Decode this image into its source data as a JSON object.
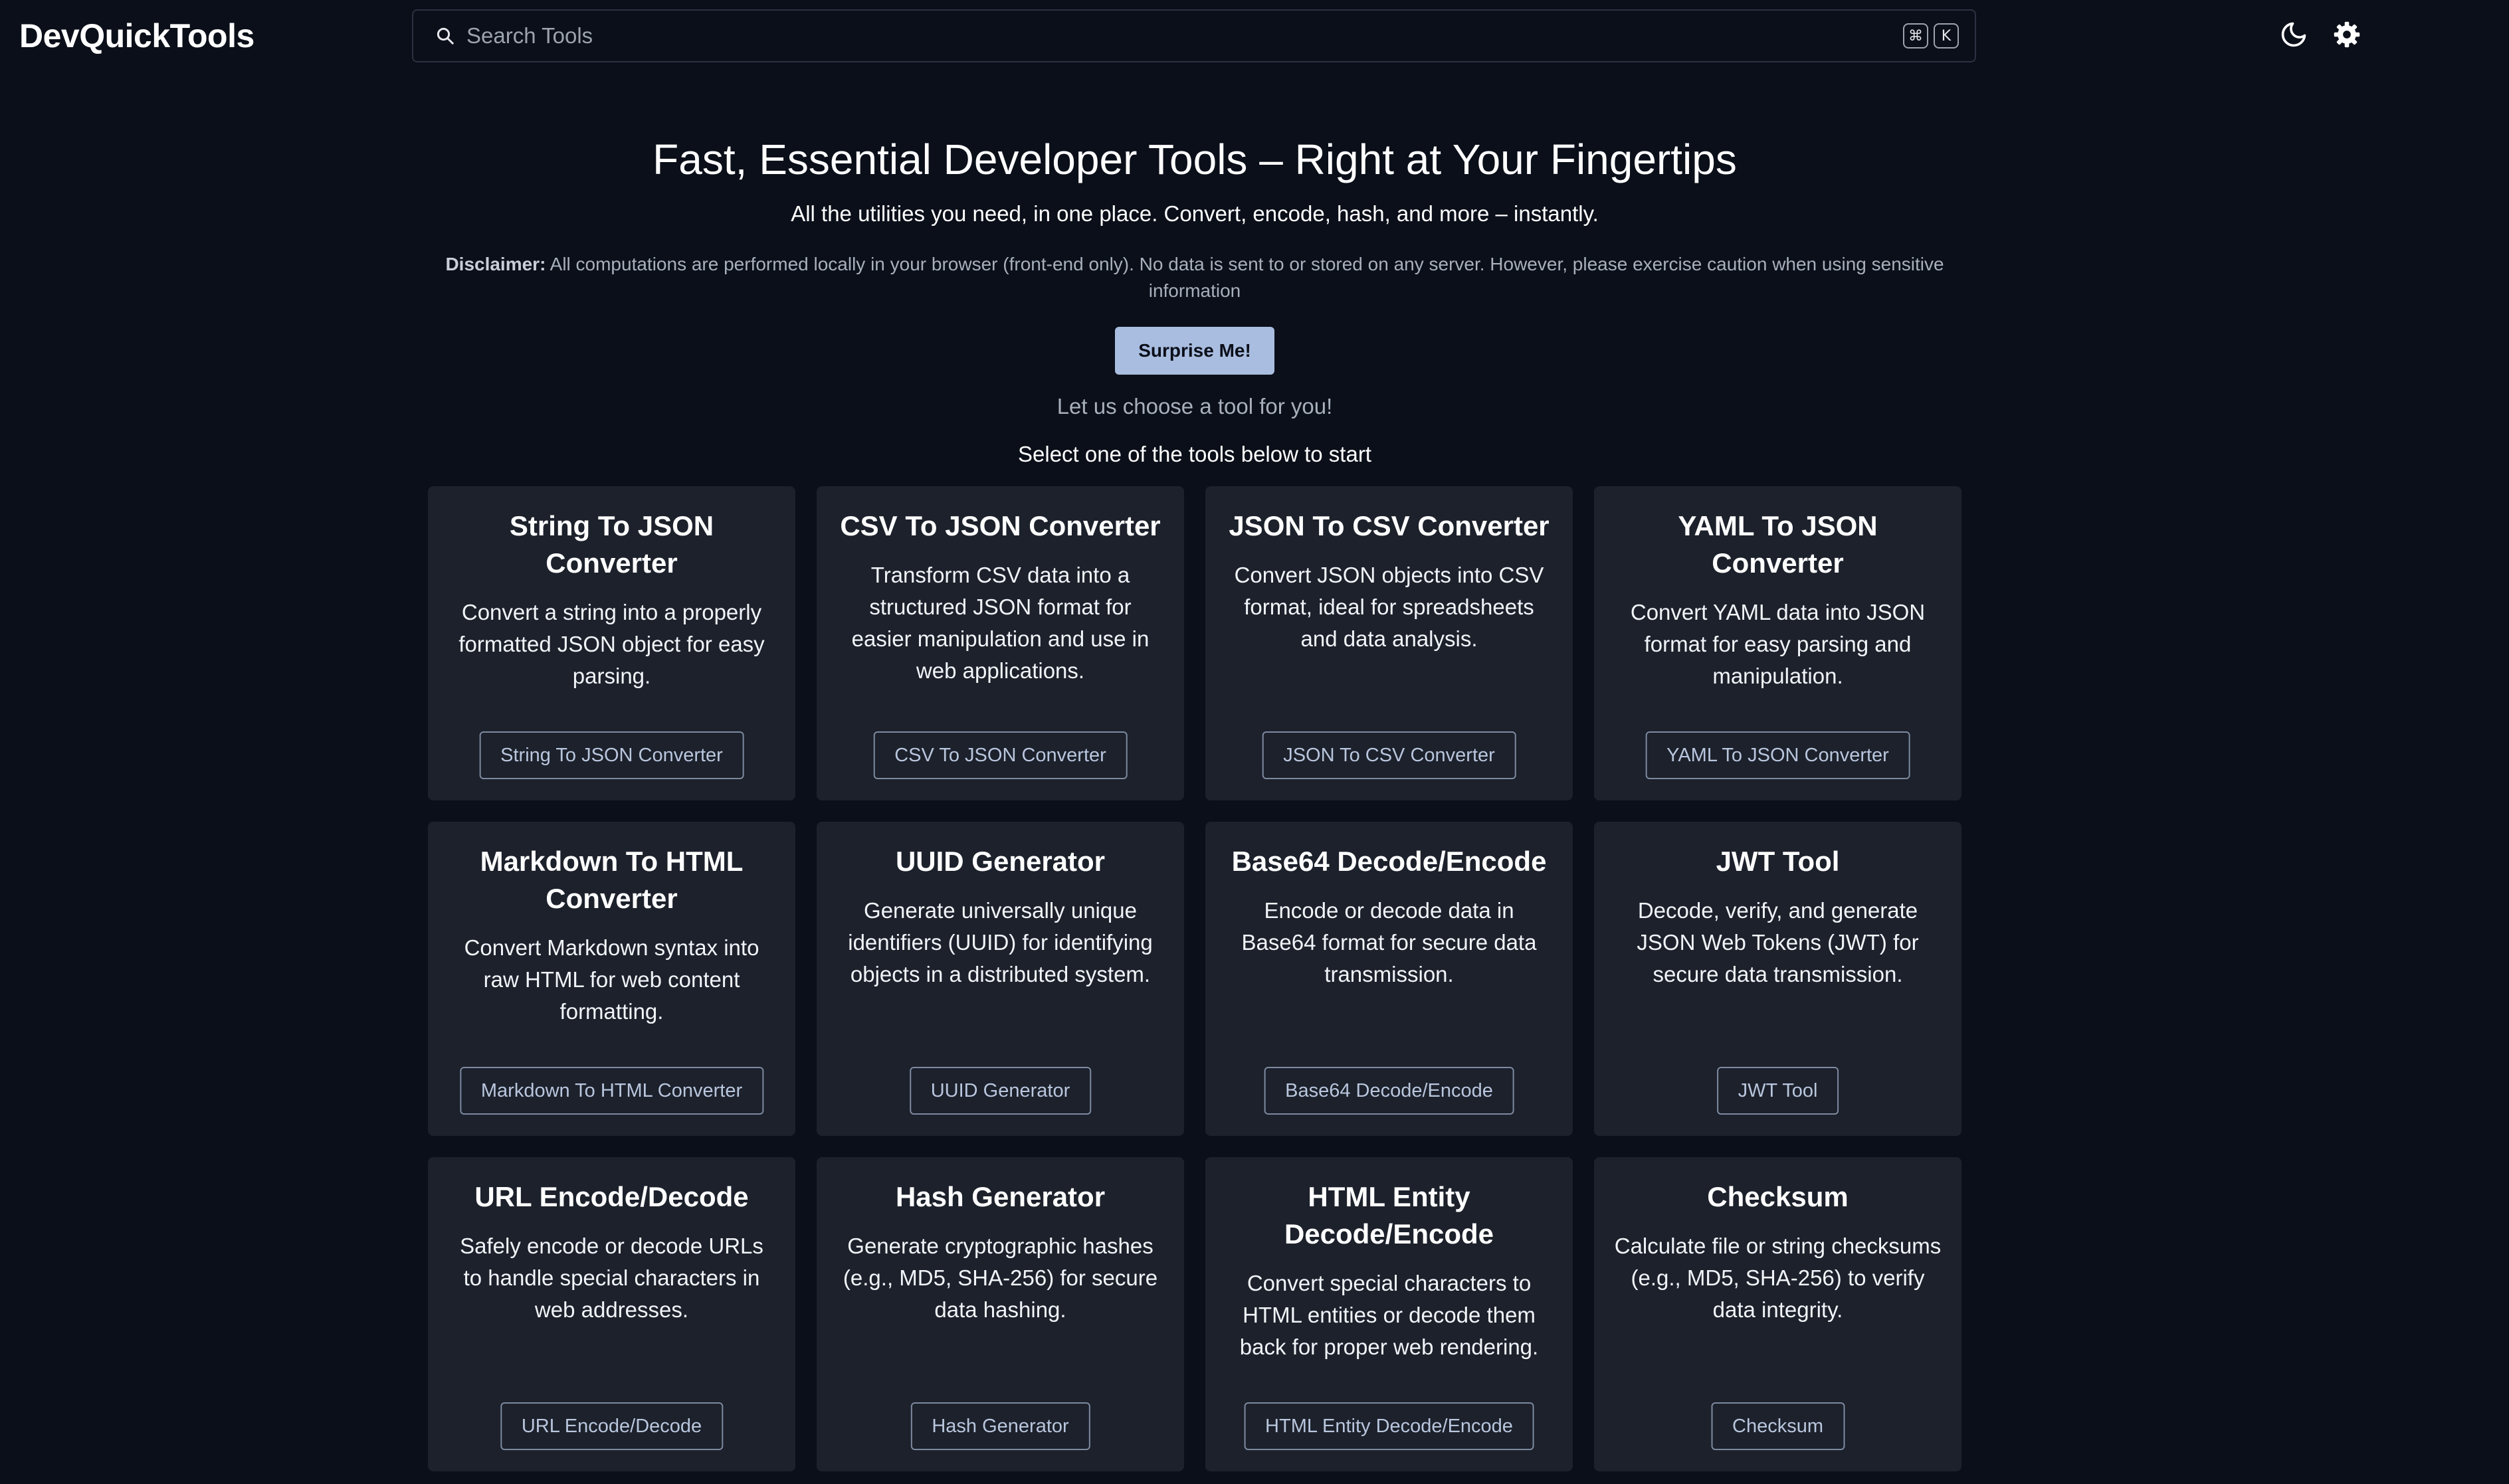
{
  "header": {
    "brand": "DevQuickTools",
    "search_placeholder": "Search Tools",
    "shortcut_keys": [
      "⌘",
      "K"
    ],
    "icons": [
      "search-icon",
      "moon-icon",
      "gear-icon"
    ]
  },
  "hero": {
    "title": "Fast, Essential Developer Tools – Right at Your Fingertips",
    "subtitle": "All the utilities you need, in one place. Convert, encode, hash, and more – instantly.",
    "disclaimer_label": "Disclaimer:",
    "disclaimer_text": " All computations are performed locally in your browser (front-end only). No data is sent to or stored on any server. However, please exercise caution when using sensitive information",
    "surprise_label": "Surprise Me!",
    "surprise_note": "Let us choose a tool for you!",
    "select_note": "Select one of the tools below to start"
  },
  "tools": [
    {
      "title": "String To JSON Converter",
      "description": "Convert a string into a properly formatted JSON object for easy parsing.",
      "button": "String To JSON Converter"
    },
    {
      "title": "CSV To JSON Converter",
      "description": "Transform CSV data into a structured JSON format for easier manipulation and use in web applications.",
      "button": "CSV To JSON Converter"
    },
    {
      "title": "JSON To CSV Converter",
      "description": "Convert JSON objects into CSV format, ideal for spreadsheets and data analysis.",
      "button": "JSON To CSV Converter"
    },
    {
      "title": "YAML To JSON Converter",
      "description": "Convert YAML data into JSON format for easy parsing and manipulation.",
      "button": "YAML To JSON Converter"
    },
    {
      "title": "Markdown To HTML Converter",
      "description": "Convert Markdown syntax into raw HTML for web content formatting.",
      "button": "Markdown To HTML Converter"
    },
    {
      "title": "UUID Generator",
      "description": "Generate universally unique identifiers (UUID) for identifying objects in a distributed system.",
      "button": "UUID Generator"
    },
    {
      "title": "Base64 Decode/Encode",
      "description": "Encode or decode data in Base64 format for secure data transmission.",
      "button": "Base64 Decode/Encode"
    },
    {
      "title": "JWT Tool",
      "description": "Decode, verify, and generate JSON Web Tokens (JWT) for secure data transmission.",
      "button": "JWT Tool"
    },
    {
      "title": "URL Encode/Decode",
      "description": "Safely encode or decode URLs to handle special characters in web addresses.",
      "button": "URL Encode/Decode"
    },
    {
      "title": "Hash Generator",
      "description": "Generate cryptographic hashes (e.g., MD5, SHA-256) for secure data hashing.",
      "button": "Hash Generator"
    },
    {
      "title": "HTML Entity Decode/Encode",
      "description": "Convert special characters to HTML entities or decode them back for proper web rendering.",
      "button": "HTML Entity Decode/Encode"
    },
    {
      "title": "Checksum",
      "description": "Calculate file or string checksums (e.g., MD5, SHA-256) to verify data integrity.",
      "button": "Checksum"
    }
  ],
  "colors": {
    "background": "#0b0f19",
    "card": "#1c212b",
    "accent_button": "#a9bde0",
    "card_button_text": "#b9c6de"
  }
}
